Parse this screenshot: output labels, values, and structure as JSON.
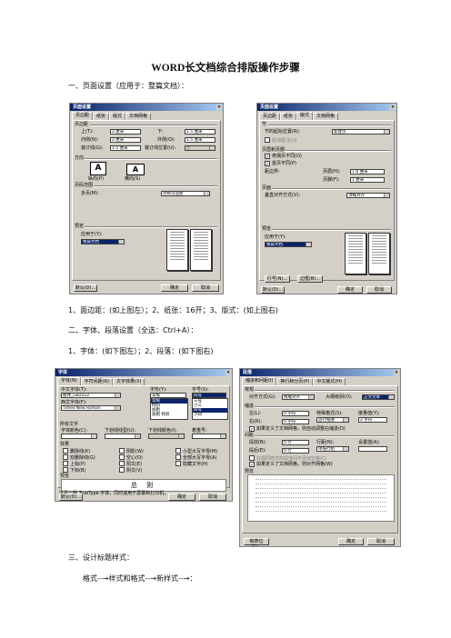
{
  "document": {
    "title": "WORD长文档综合排版操作步骤",
    "section1_heading": "一、页面设置（应用于：整篇文档）：",
    "caption1": "1、面边距：(如上图左）；2、纸张：16开；3、版式：(如上图右)",
    "section2_heading": "二、字体、段落设置（全选：Ctrl+A）：",
    "caption2": "1、字体：(如下图左）；2、段落：(如下图右)",
    "section3_heading": "三、设计标题样式：",
    "section3_step": "格式--→样式和格式--→新样式--→："
  },
  "dialog1": {
    "title": "页面设置",
    "tabs": [
      "页边距",
      "纸张",
      "版式",
      "文档网格"
    ],
    "margins_group": "页边距",
    "top_label": "上(T):",
    "top_value": "2 厘米",
    "bottom_label": "下:",
    "bottom_value": "1.5 厘米",
    "inside_label": "内侧(N):",
    "inside_value": "2 厘米",
    "outside_label": "外侧(O):",
    "outside_value": "1.5 厘米",
    "gutter_label": "装订线(G):",
    "gutter_value": "1.5 厘米",
    "gutter_pos_label": "装订线位置(U):",
    "gutter_pos_value": "左",
    "orientation_group": "方向",
    "portrait_label": "纵向(P)",
    "landscape_label": "横向(S)",
    "pages_group": "页码范围",
    "multiple_label": "多页(M):",
    "multiple_value": "对称页边距",
    "preview_group": "预览",
    "apply_label": "应用于(Y):",
    "apply_value": "整篇文档",
    "default_btn": "默认(D)...",
    "ok_btn": "确定",
    "cancel_btn": "取消"
  },
  "dialog2": {
    "title": "页面设置",
    "tabs": [
      "页边距",
      "纸张",
      "版式",
      "文档网格"
    ],
    "section_group": "节",
    "section_start_label": "节的起始位置(R):",
    "section_start_value": "新建页",
    "suppress_label": "取消尾注(U)",
    "hf_group": "页眉和页脚",
    "oddeven_label": "奇偶页不同(O)",
    "firstpage_label": "首页不同(P)",
    "edge_label": "距边界:",
    "header_label": "页眉(H):",
    "header_value": "1.8 厘米",
    "footer_label": "页脚(F):",
    "footer_value": "1 厘米",
    "page_group": "页面",
    "valign_label": "垂直对齐方式(V):",
    "valign_value": "顶端对齐",
    "preview_group": "预览",
    "apply_label": "应用于(Y):",
    "apply_value": "整篇文档",
    "linenum_btn": "行号(N)...",
    "border_btn": "边框(B)...",
    "default_btn": "默认(D)...",
    "ok_btn": "确定",
    "cancel_btn": "取消"
  },
  "dialog3": {
    "title": "字体",
    "tabs": [
      "字体(N)",
      "字符间距(R)",
      "文字效果(X)"
    ],
    "cn_font_label": "中文字体(T):",
    "cn_font_value": "楷体_GB2312",
    "style_label": "字形(Y):",
    "style_value": "常规",
    "size_label": "字号(S):",
    "size_value": "四号",
    "style_options": [
      "常规",
      "倾斜",
      "加粗",
      "加粗 倾斜"
    ],
    "size_options": [
      "三号",
      "小三",
      "四号",
      "小四"
    ],
    "west_font_label": "西文字体(F):",
    "west_font_value": "Times New Roman",
    "all_text_group": "所有文字",
    "color_label": "字体颜色(C):",
    "underline_label": "下划线线型(U):",
    "ul_color_label": "下划线颜色(I):",
    "emphasis_label": "着重号:",
    "effects_group": "效果",
    "effects": [
      "删除线(K)",
      "双删除线(G)",
      "上标(P)",
      "下标(B)",
      "阴影(W)",
      "空心(O)",
      "阳文(E)",
      "阴文(V)",
      "小型大写字母(M)",
      "全部大写字母(A)",
      "隐藏文字(H)"
    ],
    "preview_group": "预览",
    "preview_text": "总 则",
    "preview_note": "这是一种 TrueType 字体，同时适用于屏幕和打印机。",
    "default_btn": "默认(D)...",
    "ok_btn": "确定",
    "cancel_btn": "取消"
  },
  "dialog4": {
    "title": "段落",
    "tabs": [
      "缩进和间距(I)",
      "换行和分页(P)",
      "中文版式(H)"
    ],
    "general_group": "常规",
    "align_label": "对齐方式(G):",
    "align_value": "两端对齐",
    "outline_label": "大纲级别(O):",
    "outline_value": "正文文本",
    "indent_group": "缩进",
    "left_label": "左(L):",
    "left_value": "0 字符",
    "right_label": "右(R):",
    "right_value": "0 字符",
    "special_label": "特殊格式(S):",
    "special_value": "首行缩进",
    "by_label": "度量值(Y):",
    "by_value": "2 字符",
    "auto_indent_label": "如果定义了文档网格，则自动调整右缩进(D)",
    "spacing_group": "间距",
    "before_label": "段前(B):",
    "before_value": "0 行",
    "after_label": "段后(E):",
    "after_value": "0 行",
    "line_label": "行距(N):",
    "line_value": "单倍行距",
    "at_label": "设置值(A):",
    "no_space_label": "在相同样式的段落间不添加空格(C)",
    "snap_grid_label": "如果定义了文档网格，则对齐网格(W)",
    "preview_group": "预览",
    "default_btn": "制表位(T)...",
    "ok_btn": "确定",
    "cancel_btn": "取消"
  }
}
